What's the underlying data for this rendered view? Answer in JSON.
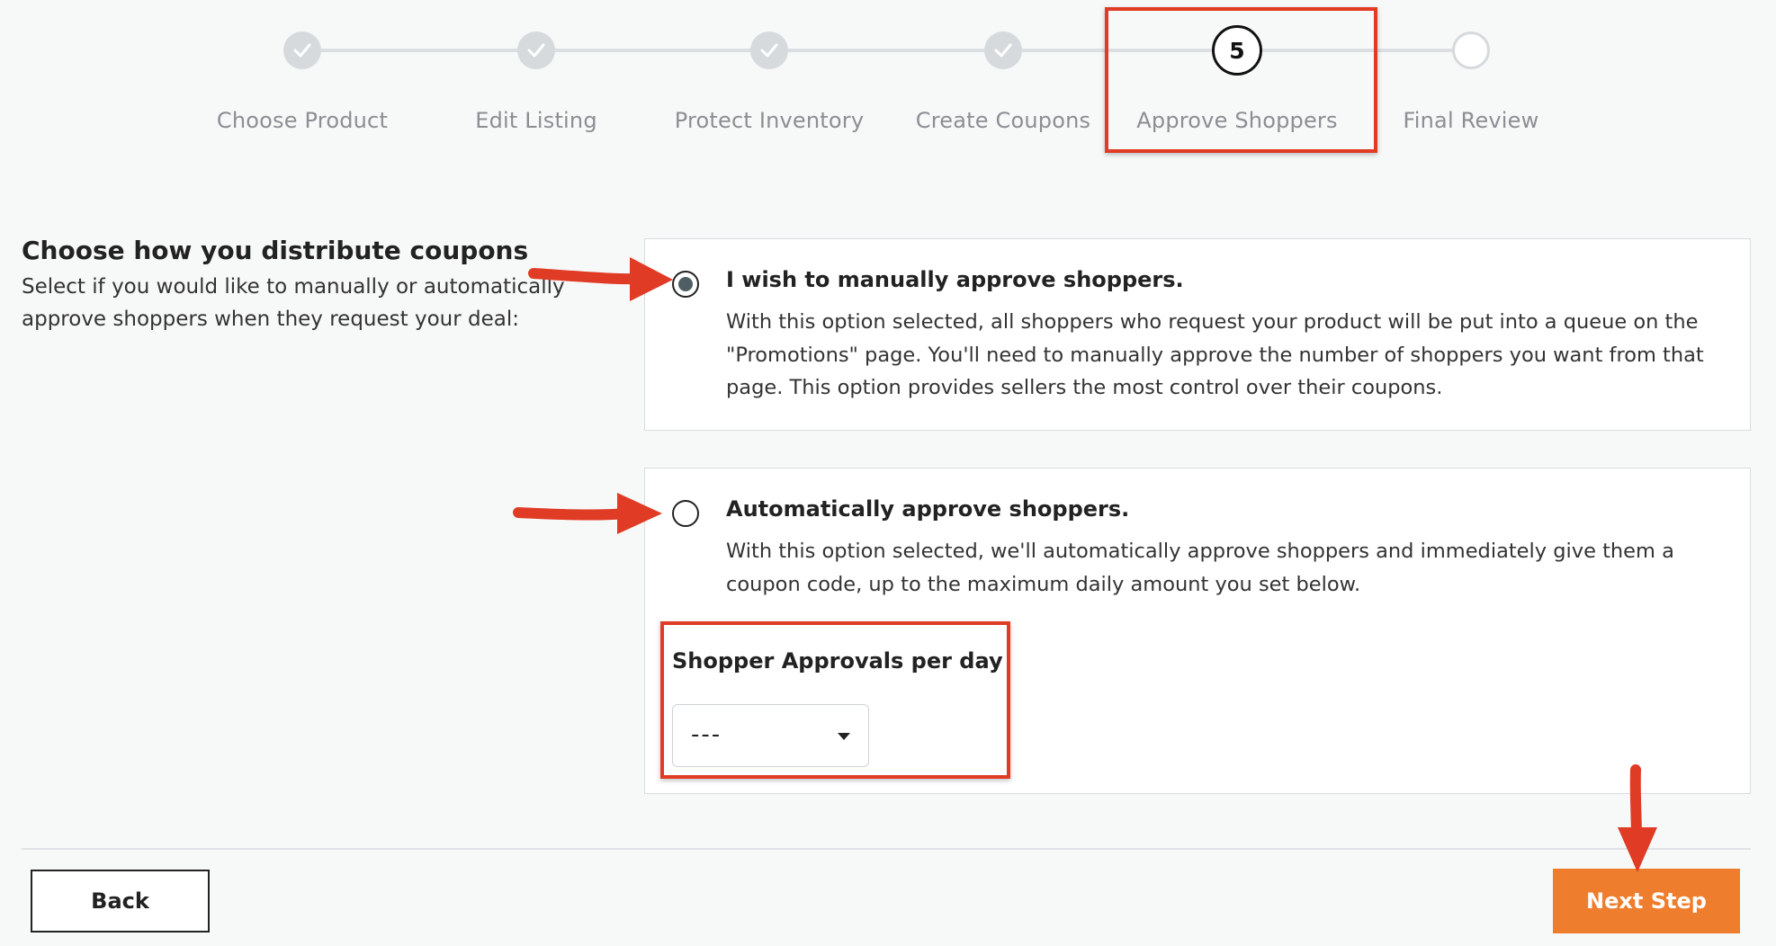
{
  "stepper": {
    "steps": [
      {
        "label": "Choose Product",
        "state": "done"
      },
      {
        "label": "Edit Listing",
        "state": "done"
      },
      {
        "label": "Protect Inventory",
        "state": "done"
      },
      {
        "label": "Create Coupons",
        "state": "done"
      },
      {
        "label": "Approve Shoppers",
        "state": "current",
        "number": "5"
      },
      {
        "label": "Final Review",
        "state": "todo"
      }
    ]
  },
  "intro": {
    "title": "Choose how you distribute coupons",
    "description": "Select if you would like to manually or automatically approve shoppers when they request your deal:"
  },
  "options": {
    "manual": {
      "title": "I wish to manually approve shoppers.",
      "description": "With this option selected, all shoppers who request your product will be put into a queue on the \"Promotions\" page. You'll need to manually approve the number of shoppers you want from that page. This option provides sellers the most control over their coupons.",
      "selected": true
    },
    "automatic": {
      "title": "Automatically approve shoppers.",
      "description": "With this option selected, we'll automatically approve shoppers and immediately give them a coupon code, up to the maximum daily amount you set below.",
      "selected": false,
      "approvals_label": "Shopper Approvals per day",
      "approvals_value": "---"
    }
  },
  "footer": {
    "back_label": "Back",
    "next_label": "Next Step"
  },
  "colors": {
    "accent": "#ee7e2e",
    "annotation": "#e03b25",
    "radio_fill": "#4e5e63"
  }
}
